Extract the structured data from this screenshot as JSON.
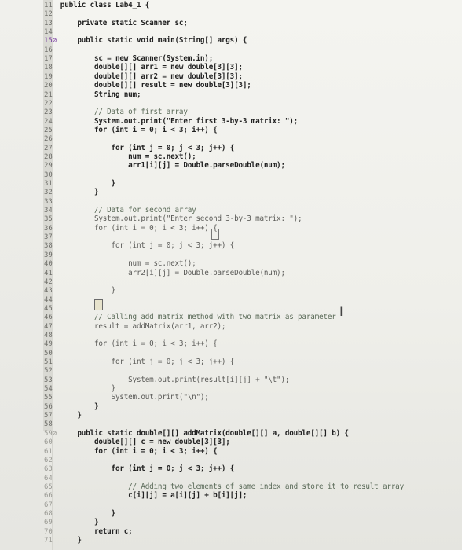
{
  "editor": {
    "line_numbers": [
      "11",
      "12",
      "13",
      "14",
      "15⊘",
      "16",
      "17",
      "18",
      "19",
      "20",
      "21",
      "22",
      "23",
      "24",
      "25",
      "26",
      "27",
      "28",
      "29",
      "30",
      "31",
      "32",
      "33",
      "34",
      "35",
      "36",
      "37",
      "38",
      "39",
      "40",
      "41",
      "42",
      "43",
      "44",
      "45",
      "46",
      "47",
      "48",
      "49",
      "50",
      "51",
      "52",
      "53",
      "54",
      "55",
      "56",
      "57",
      "58",
      "59⊘",
      "60",
      "61",
      "62",
      "63",
      "64",
      "65",
      "66",
      "67",
      "68",
      "69",
      "70",
      "71"
    ],
    "lines": [
      "  public class Lab4_1 {",
      "",
      "      private static Scanner sc;",
      "",
      "      public static void main(String[] args) {",
      "",
      "          sc = new Scanner(System.in);",
      "          double[][] arr1 = new double[3][3];",
      "          double[][] arr2 = new double[3][3];",
      "          double[][] result = new double[3][3];",
      "          String num;",
      "",
      "          // Data of first array",
      "          System.out.print(\"Enter first 3-by-3 matrix: \");",
      "          for (int i = 0; i < 3; i++) {",
      "",
      "              for (int j = 0; j < 3; j++) {",
      "                  num = sc.next();",
      "                  arr1[i][j] = Double.parseDouble(num);",
      "",
      "              }",
      "          }",
      "",
      "          // Data for second array",
      "          System.out.print(\"Enter second 3-by-3 matrix: \");",
      "          for (int i = 0; i < 3; i++) {",
      "",
      "              for (int j = 0; j < 3; j++) {",
      "",
      "                  num = sc.next();",
      "                  arr2[i][j] = Double.parseDouble(num);",
      "",
      "              }",
      "",
      "",
      "          // Calling add matrix method with two matrix as parameter",
      "          result = addMatrix(arr1, arr2);",
      "",
      "          for (int i = 0; i < 3; i++) {",
      "",
      "              for (int j = 0; j < 3; j++) {",
      "",
      "                  System.out.print(result[i][j] + \"\\t\");",
      "              }",
      "              System.out.print(\"\\n\");",
      "          }",
      "      }",
      "",
      "      public static double[][] addMatrix(double[][] a, double[][] b) {",
      "          double[][] c = new double[3][3];",
      "          for (int i = 0; i < 3; i++) {",
      "",
      "              for (int j = 0; j < 3; j++) {",
      "",
      "                  // Adding two elements of same index and store it to result array",
      "                  c[i][j] = a[i][j] + b[i][j];",
      "",
      "              }",
      "          }",
      "          return c;",
      "      }"
    ]
  }
}
